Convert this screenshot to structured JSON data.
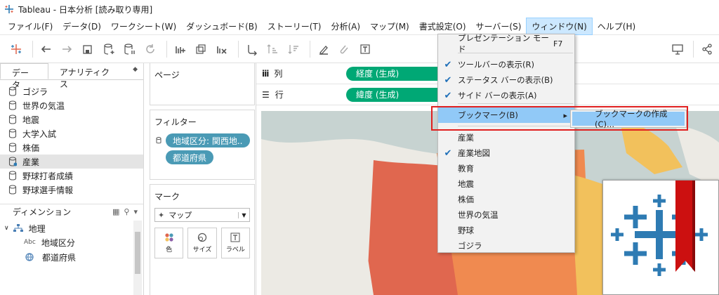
{
  "window": {
    "title": "Tableau - 日本分析 [読み取り専用]"
  },
  "menubar": {
    "items": [
      "ファイル(F)",
      "データ(D)",
      "ワークシート(W)",
      "ダッシュボード(B)",
      "ストーリー(T)",
      "分析(A)",
      "マップ(M)",
      "書式設定(O)",
      "サーバー(S)",
      "ウィンドウ(N)",
      "ヘルプ(H)"
    ],
    "active": "ウィンドウ(N)"
  },
  "left_panel": {
    "tabs": [
      "データ",
      "アナリティクス"
    ],
    "data_sources": [
      {
        "label": "ゴジラ",
        "selected": false
      },
      {
        "label": "世界の気温",
        "selected": false
      },
      {
        "label": "地震",
        "selected": false
      },
      {
        "label": "大学入試",
        "selected": false
      },
      {
        "label": "株価",
        "selected": false
      },
      {
        "label": "産業",
        "selected": true
      },
      {
        "label": "野球打者成績",
        "selected": false
      },
      {
        "label": "野球選手情報",
        "selected": false
      }
    ],
    "dimensions_header": "ディメンション",
    "dimensions": {
      "folder": "地理",
      "fields": [
        {
          "type_label": "Abc",
          "label": "地域区分"
        },
        {
          "type_label": "",
          "label": "都道府県"
        }
      ]
    }
  },
  "cards": {
    "pages_title": "ページ",
    "filters_title": "フィルター",
    "filters": [
      "地域区分: 関西地..",
      "都道府県"
    ],
    "marks_title": "マーク",
    "mark_type": "マップ",
    "mark_buttons": [
      "色",
      "サイズ",
      "ラベル"
    ]
  },
  "shelves": {
    "columns_label": "列",
    "columns_pill": "経度 (生成)",
    "rows_label": "行",
    "rows_pill": "緯度 (生成)"
  },
  "window_menu": {
    "items": [
      {
        "label": "プレゼンテーション モード",
        "shortcut": "F7",
        "checked": false
      },
      {
        "label": "ツールバーの表示(R)",
        "shortcut": "",
        "checked": true
      },
      {
        "label": "ステータス バーの表示(B)",
        "shortcut": "",
        "checked": true
      },
      {
        "label": "サイド バーの表示(A)",
        "shortcut": "",
        "checked": true
      },
      {
        "label": "ブックマーク(B)",
        "shortcut": "",
        "checked": false
      },
      {
        "label": "産業",
        "shortcut": "",
        "checked": false
      },
      {
        "label": "産業地図",
        "shortcut": "",
        "checked": true
      },
      {
        "label": "教育",
        "shortcut": "",
        "checked": false
      },
      {
        "label": "地震",
        "shortcut": "",
        "checked": false
      },
      {
        "label": "株価",
        "shortcut": "",
        "checked": false
      },
      {
        "label": "世界の気温",
        "shortcut": "",
        "checked": false
      },
      {
        "label": "野球",
        "shortcut": "",
        "checked": false
      },
      {
        "label": "ゴジラ",
        "shortcut": "",
        "checked": false
      }
    ],
    "submenu_item": "ブックマークの作成(C)..."
  },
  "colors": {
    "menu_highlight": "#91c9f7",
    "pill_blue": "#4a9ab5",
    "pill_green": "#00a875",
    "callout_red": "#e02020",
    "map_orange_dark": "#e0674f",
    "map_orange": "#f08a50",
    "map_yellow": "#f2c15c",
    "logo_blue": "#2e7bb3",
    "bookmark_red": "#cc1010"
  }
}
